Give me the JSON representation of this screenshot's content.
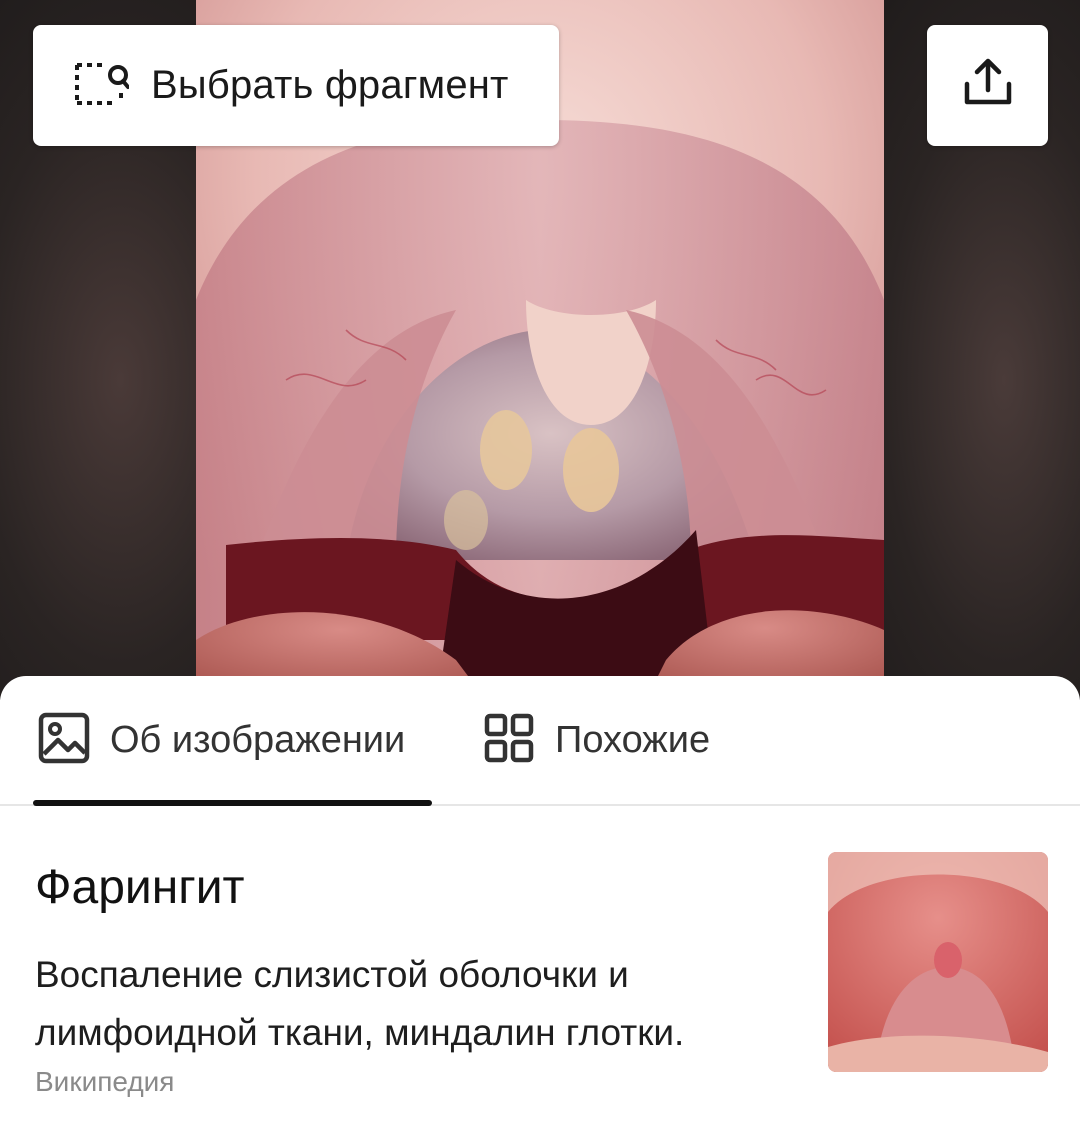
{
  "toolbar": {
    "select_fragment_label": "Выбрать фрагмент",
    "select_fragment_icon": "crop-search-icon",
    "share_icon": "share-upload-icon"
  },
  "tabs": [
    {
      "label": "Об изображении",
      "icon": "image-icon",
      "active": true
    },
    {
      "label": "Похожие",
      "icon": "grid-icon",
      "active": false
    }
  ],
  "entity": {
    "title": "Фарингит",
    "description": "Воспаление слизистой оболочки и лимфоидной ткани, миндалин глотки.",
    "source": "Википедия"
  },
  "colors": {
    "accent_underline": "#111111",
    "muted_text": "#8a8a8a",
    "viewer_background": "#221d1d"
  }
}
